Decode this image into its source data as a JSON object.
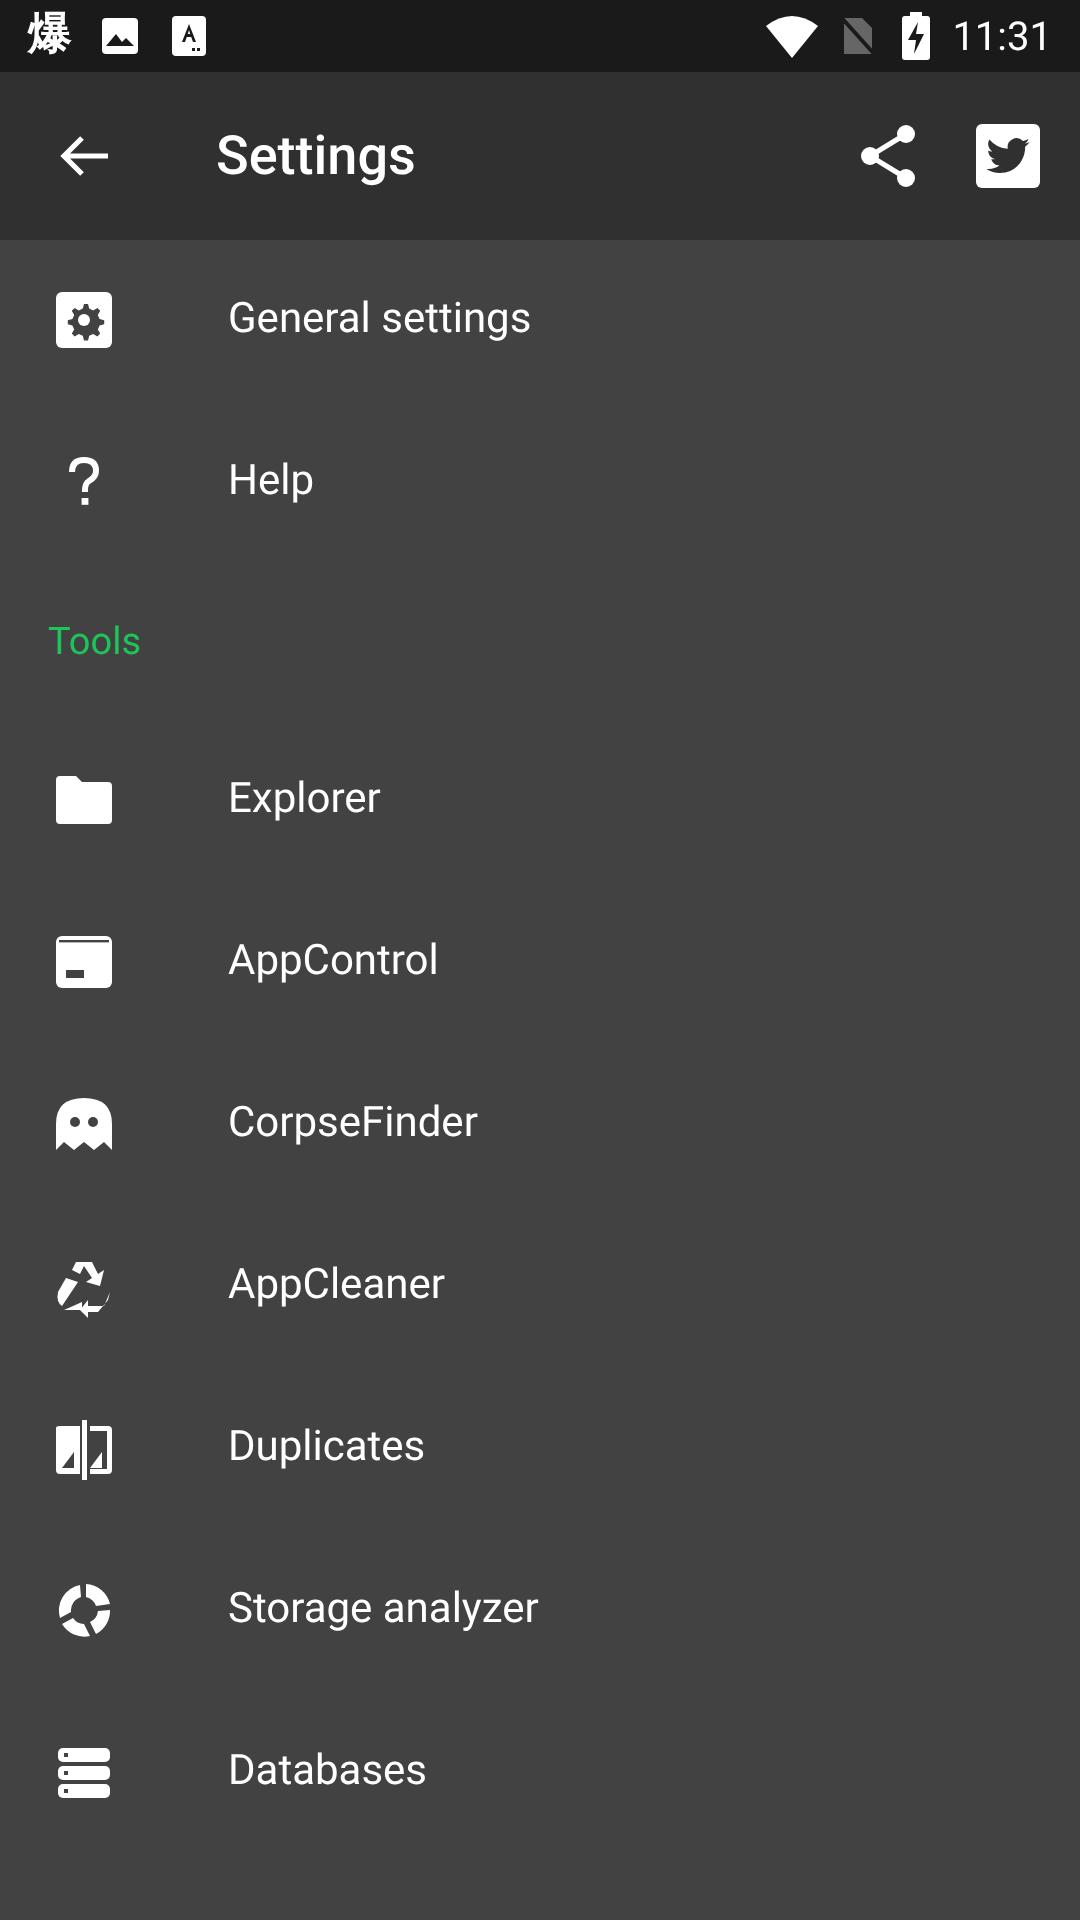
{
  "status_bar": {
    "notification": "爆",
    "time": "11:31"
  },
  "toolbar": {
    "title": "Settings"
  },
  "list": [
    {
      "kind": "item",
      "label": "General settings"
    },
    {
      "kind": "item",
      "label": "Help"
    },
    {
      "kind": "header",
      "label": "Tools"
    },
    {
      "kind": "item",
      "label": "Explorer"
    },
    {
      "kind": "item",
      "label": "AppControl"
    },
    {
      "kind": "item",
      "label": "CorpseFinder"
    },
    {
      "kind": "item",
      "label": "AppCleaner"
    },
    {
      "kind": "item",
      "label": "Duplicates"
    },
    {
      "kind": "item",
      "label": "Storage analyzer"
    },
    {
      "kind": "item",
      "label": "Databases"
    }
  ]
}
